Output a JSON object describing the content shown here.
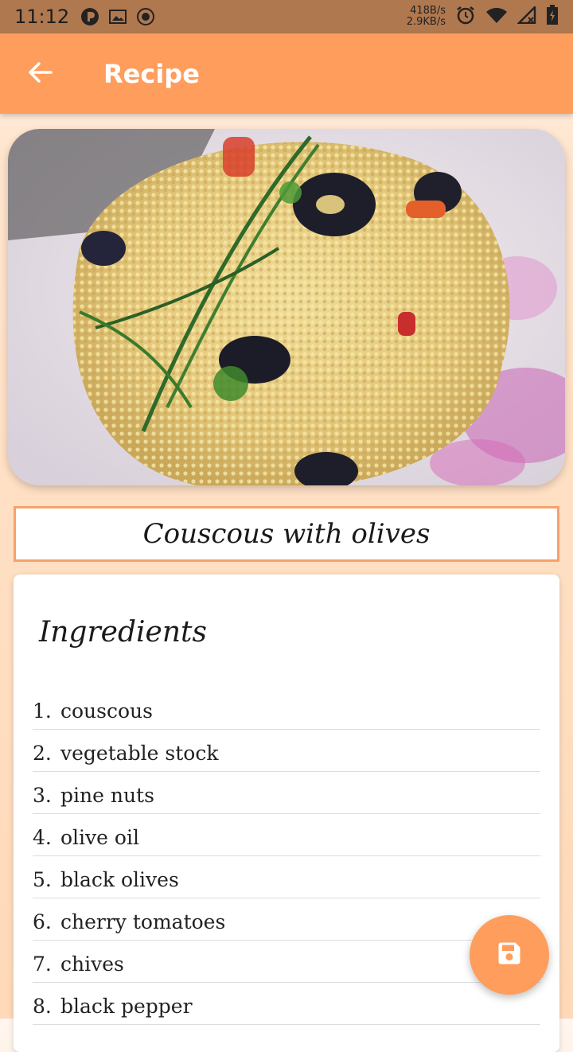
{
  "status_bar": {
    "time": "11:12",
    "net_up": "418B/s",
    "net_down": "2.9KB/s",
    "icons": [
      "p-badge-icon",
      "image-icon",
      "record-icon",
      "alarm-icon",
      "wifi-icon",
      "signal-icon",
      "battery-icon"
    ]
  },
  "app_bar": {
    "title": "Recipe",
    "back_icon": "arrow-left-icon"
  },
  "recipe": {
    "image_alt": "couscous with olives photo",
    "title": "Couscous with olives"
  },
  "ingredients": {
    "heading": "Ingredients",
    "items": [
      {
        "num": "1.",
        "name": "couscous"
      },
      {
        "num": "2.",
        "name": "vegetable stock"
      },
      {
        "num": "3.",
        "name": "pine nuts"
      },
      {
        "num": "4.",
        "name": "olive oil"
      },
      {
        "num": "5.",
        "name": "black olives"
      },
      {
        "num": "6.",
        "name": "cherry tomatoes"
      },
      {
        "num": "7.",
        "name": "chives"
      },
      {
        "num": "8.",
        "name": "black pepper"
      }
    ]
  },
  "fab": {
    "icon": "save-icon"
  },
  "colors": {
    "accent": "#ff9d5c",
    "status_bar": "#b0784f",
    "border": "#f5a26b"
  }
}
